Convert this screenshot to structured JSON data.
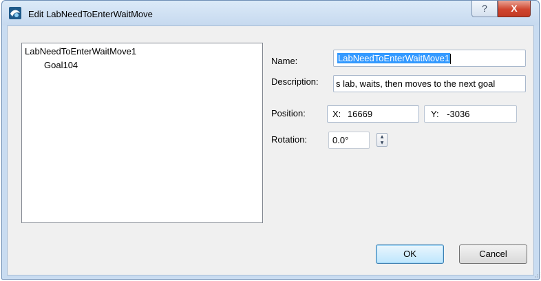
{
  "window": {
    "title": "Edit LabNeedToEnterWaitMove",
    "help_symbol": "?",
    "close_symbol": "X"
  },
  "tree": {
    "items": [
      {
        "label": "LabNeedToEnterWaitMove1"
      },
      {
        "label": "Goal104"
      }
    ]
  },
  "form": {
    "name_label": "Name:",
    "name_value": "LabNeedToEnterWaitMove1",
    "description_label": "Description:",
    "description_value": "s lab, waits, then moves to the next goal",
    "position_label": "Position:",
    "x_label": "X:",
    "x_value": "16669",
    "y_label": "Y:",
    "y_value": "-3036",
    "rotation_label": "Rotation:",
    "rotation_value": "0.0°"
  },
  "buttons": {
    "ok_label": "OK",
    "cancel_label": "Cancel"
  },
  "icons": {
    "app": "app-logo-icon",
    "help": "help-icon",
    "close": "close-icon",
    "spin_up": "spin-up-icon",
    "spin_down": "spin-down-icon",
    "resize": "resize-grip-icon"
  },
  "colors": {
    "selection": "#3399ff",
    "close_button": "#c9452f",
    "title_bar": "#c9dcf1"
  }
}
